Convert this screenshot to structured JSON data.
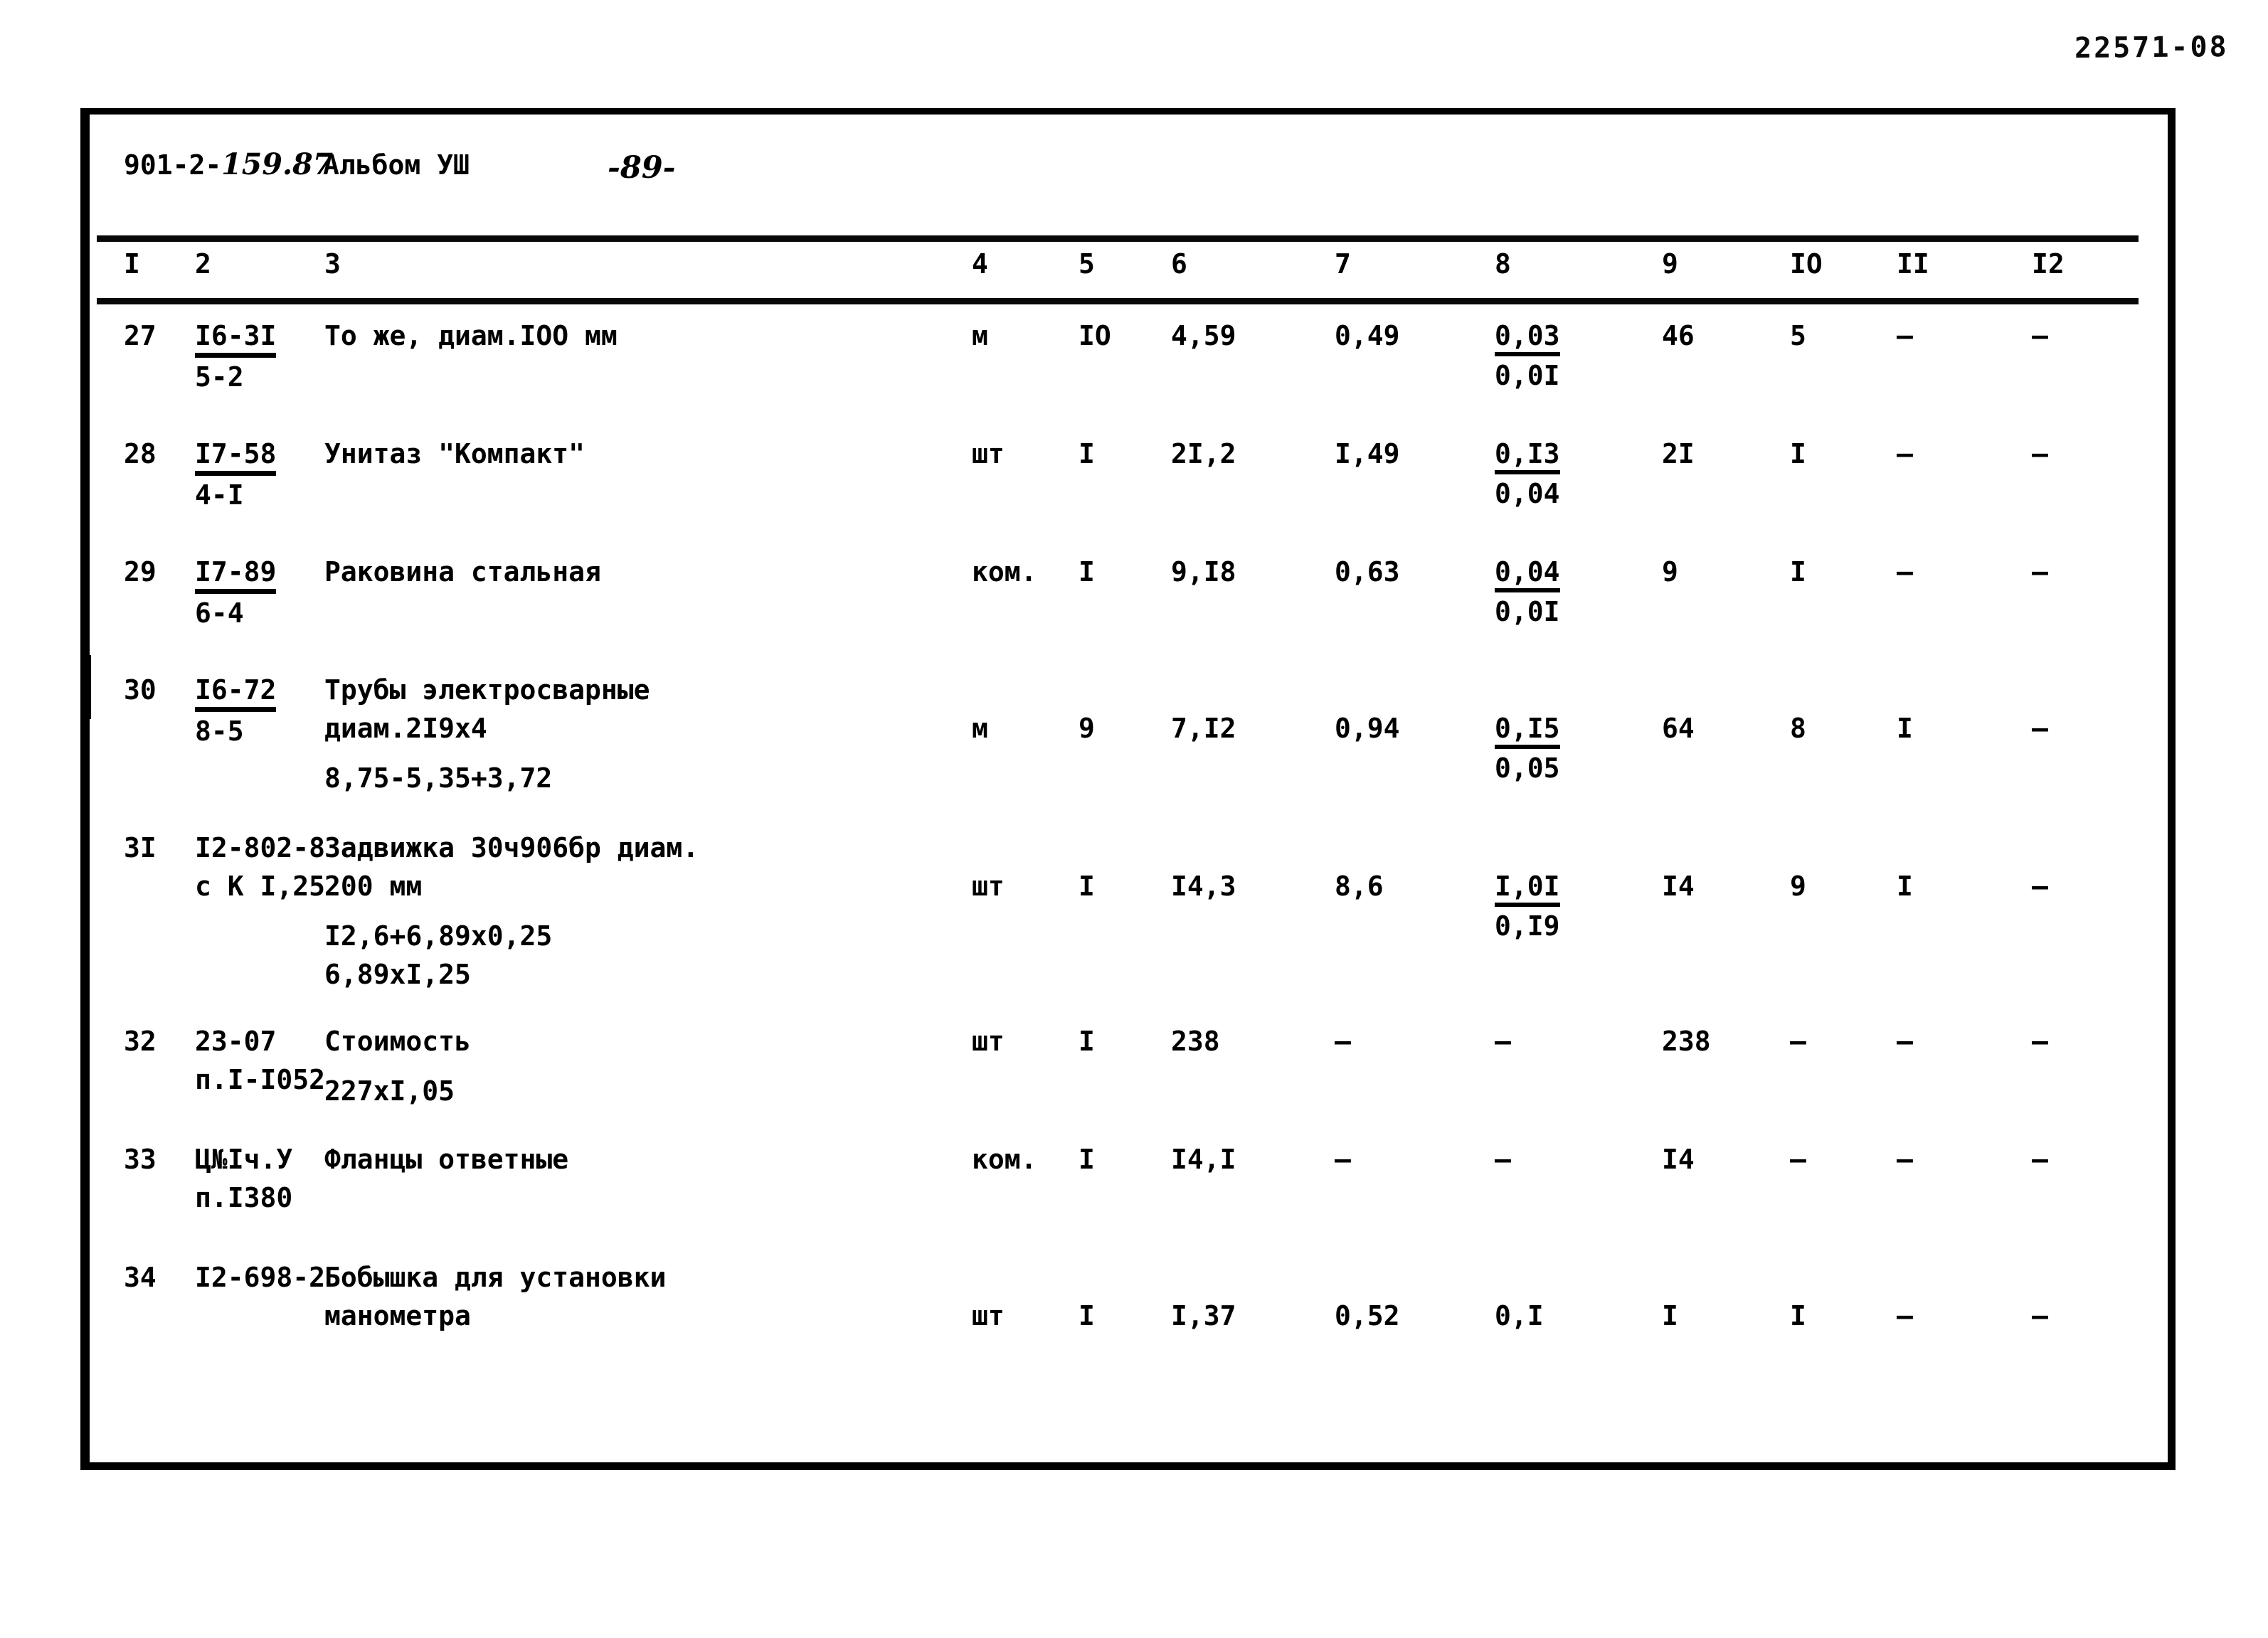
{
  "archive_stamp": "22571-08",
  "header": {
    "doc_code_prefix": "901-2-",
    "doc_code_handwritten": "159.87",
    "album": "Альбом УШ",
    "page_number": "-89-"
  },
  "table": {
    "column_headers": [
      "I",
      "2",
      "3",
      "4",
      "5",
      "6",
      "7",
      "8",
      "9",
      "IO",
      "II",
      "I2"
    ],
    "rows": [
      {
        "num": "27",
        "code_top": "I6-3I",
        "code_sub": "5-2",
        "desc_lines": [
          "То же, диам.IOO мм"
        ],
        "unit": "м",
        "c5": "IO",
        "c6": "4,59",
        "c7": "0,49",
        "c8_top": "0,03",
        "c8_sub": "0,0I",
        "c9": "46",
        "c10": "5",
        "c11": "–",
        "c12": "–"
      },
      {
        "num": "28",
        "code_top": "I7-58",
        "code_sub": "4-I",
        "desc_lines": [
          "Унитаз \"Компакт\""
        ],
        "unit": "шт",
        "c5": "I",
        "c6": "2I,2",
        "c7": "I,49",
        "c8_top": "0,I3",
        "c8_sub": "0,04",
        "c9": "2I",
        "c10": "I",
        "c11": "–",
        "c12": "–"
      },
      {
        "num": "29",
        "code_top": "I7-89",
        "code_sub": "6-4",
        "desc_lines": [
          "Раковина стальная"
        ],
        "unit": "ком.",
        "c5": "I",
        "c6": "9,I8",
        "c7": "0,63",
        "c8_top": "0,04",
        "c8_sub": "0,0I",
        "c9": "9",
        "c10": "I",
        "c11": "–",
        "c12": "–"
      },
      {
        "num": "30",
        "code_top": "I6-72",
        "code_sub": "8-5",
        "desc_lines": [
          "Трубы электросварные",
          "диам.2I9х4",
          "8,75-5,35+3,72"
        ],
        "unit": "м",
        "c5": "9",
        "c6": "7,I2",
        "c7": "0,94",
        "c8_top": "0,I5",
        "c8_sub": "0,05",
        "c9": "64",
        "c10": "8",
        "c11": "I",
        "c12": "–"
      },
      {
        "num": "3I",
        "code_top": "I2-802-8",
        "code_sub": "с К I,25",
        "code_plain": true,
        "desc_lines": [
          "Задвижка 30ч906бр диам.",
          "200 мм",
          "I2,6+6,89х0,25",
          "6,89хI,25"
        ],
        "unit": "шт",
        "c5": "I",
        "c6": "I4,3",
        "c7": "8,6",
        "c8_top": "I,0I",
        "c8_sub": "0,I9",
        "c9": "I4",
        "c10": "9",
        "c11": "I",
        "c12": "–"
      },
      {
        "num": "32",
        "code_top": "23-07",
        "code_sub": "п.I-I052",
        "code_plain": true,
        "desc_lines": [
          "Стоимость",
          "227хI,05"
        ],
        "unit": "шт",
        "c5": "I",
        "c6": "238",
        "c7": "–",
        "c8_top": "–",
        "c8_sub": "",
        "c9": "238",
        "c10": "–",
        "c11": "–",
        "c12": "–"
      },
      {
        "num": "33",
        "code_top": "Ц№Iч.У",
        "code_sub": "п.I380",
        "code_plain": true,
        "desc_lines": [
          "Фланцы ответные"
        ],
        "unit": "ком.",
        "c5": "I",
        "c6": "I4,I",
        "c7": "–",
        "c8_top": "–",
        "c8_sub": "",
        "c9": "I4",
        "c10": "–",
        "c11": "–",
        "c12": "–"
      },
      {
        "num": "34",
        "code_top": "I2-698-2",
        "code_sub": "",
        "code_plain": true,
        "desc_lines": [
          "Бобышка для установки",
          "манометра"
        ],
        "unit": "шт",
        "c5": "I",
        "c6": "I,37",
        "c7": "0,52",
        "c8_top": "0,I",
        "c8_sub": "",
        "c9": "I",
        "c10": "I",
        "c11": "–",
        "c12": "–"
      }
    ]
  }
}
